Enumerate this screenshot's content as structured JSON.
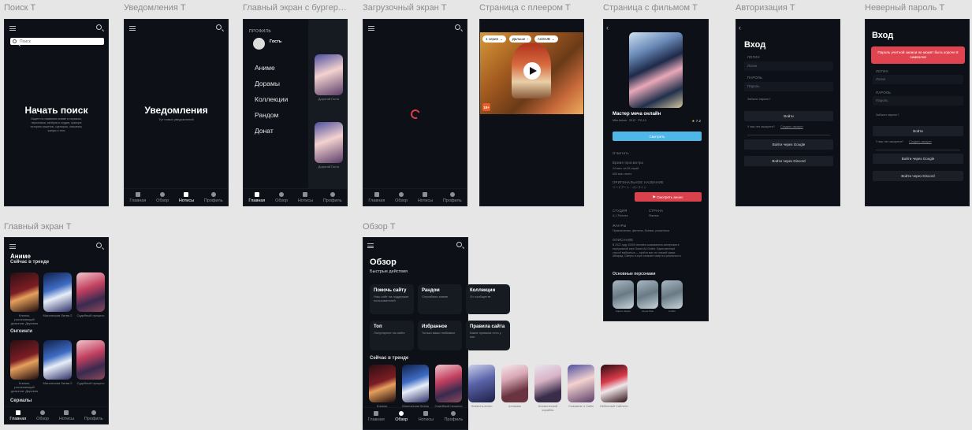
{
  "frames": {
    "search": {
      "label": "Поиск T",
      "placeholder": "Поиск",
      "title": "Начать поиск",
      "subtitle": "Ищите по названию аниме и сериалы, персонажи, актёров и студии, краткую историю сюжетов, сценарии, описания, жанры и теги"
    },
    "notifications": {
      "label": "Уведомления T",
      "title": "Уведомления",
      "subtitle": "Тут новых уведомлений"
    },
    "burger": {
      "label": "Главный экран с бургерами T",
      "profile_section": "ПРОФИЛЬ",
      "user": "Гость",
      "menu": [
        "Аниме",
        "Дорамы",
        "Коллекции",
        "Рандом",
        "Донат"
      ],
      "card_caption": "Дорогой Гость"
    },
    "loading": {
      "label": "Загрузочный экран T"
    },
    "player": {
      "label": "Страница с плеером T",
      "quality": "1 серия",
      "next": "Дальше",
      "dub": "AniDUB",
      "badge": "18+"
    },
    "movie": {
      "label": "Страница с фильмом T",
      "title": "Мастер меча онлайн",
      "meta": "Mfm Anime · 2012 · PG-13",
      "rating": "7.2",
      "watch_btn": "Смотреть",
      "status_label": "Отметить",
      "duration_label": "Время просмотра",
      "duration_value": "24 мин. на 25 серий",
      "total_value": "600 мин. всего",
      "orig_label": "ОРИГИНАЛЬНОЕ НАЗВАНИЕ",
      "orig_value": "ソードアート・オンライン",
      "trailer_btn": "Смотреть анонс",
      "studio_label": "СТУДИЯ",
      "studio_value": "A-1 Pictures",
      "country_label": "СТРАНА",
      "country_value": "Япония",
      "genres_label": "ЖАНРЫ",
      "genres_value": "Приключения, фэнтези, боевик, романтика",
      "desc_label": "ОПИСАНИЕ",
      "desc_value": "В 2022 году 10000 человек оказываются запертыми в виртуальной игре Sword Art Online. Единственный способ выбраться — пройти все сто этажей замка Айнкрад. Смерть в игре означает смерть в реальности.",
      "chars_title": "Основные персонажи",
      "chars": [
        "Кирито Кидзо",
        "Асуна Юки",
        "Кляйн"
      ]
    },
    "auth": {
      "label": "Авторизация T",
      "title": "Вход",
      "login_label": "ЛОГИН",
      "login_placeholder": "Логин",
      "pass_label": "ПАРОЛЬ",
      "pass_placeholder": "Пароль",
      "forgot": "Забыли пароль?",
      "login_btn": "Войти",
      "no_account": "У вас нет аккаунта?",
      "register": "Создать аккаунт",
      "or": "или",
      "google_btn": "Войти через Google",
      "discord_btn": "Войти через Discord"
    },
    "wrong_pass": {
      "label": "Неверный пароль T",
      "title": "Вход",
      "error": "Пароль учетной записи не может быть короче 6 символов",
      "login_label": "ЛОГИН",
      "login_placeholder": "Логин",
      "pass_label": "ПАРОЛЬ",
      "pass_placeholder": "Пароль",
      "forgot": "Забыли пароль?",
      "login_btn": "Войти",
      "no_account": "У вас нет аккаунта?",
      "register": "Создать аккаунт",
      "google_btn": "Войти через Google",
      "discord_btn": "Войти через Discord"
    },
    "home": {
      "label": "Главный экран T",
      "section": "Аниме",
      "trending": "Сейчас в тренде",
      "ongoing": "Онгоинги",
      "series": "Сериалы",
      "captions": [
        "Клинок, рассекающий демонов: Деревня",
        "Магическая битва 2",
        "Судебный процесс"
      ]
    },
    "overview": {
      "label": "Обзор T",
      "title": "Обзор",
      "quick": "Быстрые действия",
      "cards": [
        {
          "t": "Помочь сайту",
          "s": "Наш сайт на поддержке пользователей"
        },
        {
          "t": "Рандом",
          "s": "Случайное аниме"
        },
        {
          "t": "Коллекции",
          "s": "От сообществ"
        },
        {
          "t": "Топ",
          "s": "Популярное на сайте"
        },
        {
          "t": "Избранное",
          "s": "Только ваши любимые"
        },
        {
          "t": "Правила сайта",
          "s": "Какие правила есть у нас"
        }
      ],
      "trending": "Сейчас в тренде",
      "captions": [
        "Клинок, рассекающий демонов",
        "Магическая битва",
        "Судебный процесс",
        "Невеста-ангел",
        "Алхимик",
        "Космический корабль",
        "Сказание о Сайо",
        "Небесный Сайлент"
      ]
    }
  },
  "nav": [
    "Главная",
    "Обзор",
    "Нотисы",
    "Профиль"
  ]
}
